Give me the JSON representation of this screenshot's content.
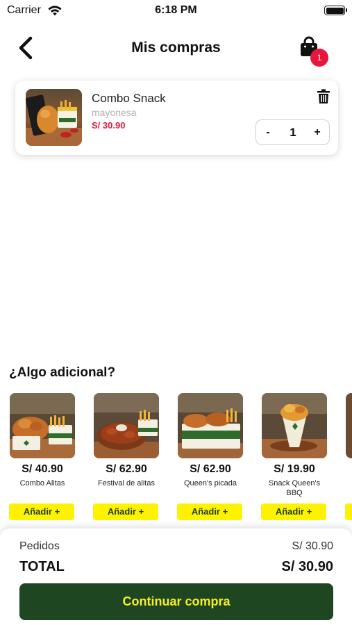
{
  "status_bar": {
    "carrier": "Carrier",
    "time": "6:18 PM",
    "battery_level": 1.0
  },
  "header": {
    "title": "Mis compras",
    "back_icon": "chevron-left-icon",
    "cart_icon": "shopping-bag-icon",
    "cart_count": "1"
  },
  "cart": {
    "items": [
      {
        "name": "Combo Snack",
        "option": "mayonesa",
        "price": "S/ 30.90",
        "quantity": "1",
        "minus_label": "-",
        "plus_label": "+"
      }
    ]
  },
  "additional": {
    "title": "¿Algo adicional?",
    "products": [
      {
        "price": "S/ 40.90",
        "name": "Combo Alitas",
        "button": "Añadir +"
      },
      {
        "price": "S/ 62.90",
        "name": "Festival de alitas",
        "button": "Añadir +"
      },
      {
        "price": "S/ 62.90",
        "name": "Queen's picada",
        "button": "Añadir +"
      },
      {
        "price": "S/ 19.90",
        "name": "Snack Queen's BBQ",
        "button": "Añadir +"
      }
    ]
  },
  "summary": {
    "subtotal_label": "Pedidos",
    "subtotal_value": "S/ 30.90",
    "total_label": "TOTAL",
    "total_value": "S/ 30.90",
    "continue_label": "Continuar compra"
  },
  "colors": {
    "accent_red": "#e8163c",
    "brand_green": "#1e4621",
    "brand_yellow": "#fff200",
    "button_text_yellow": "#f5ee2a"
  }
}
